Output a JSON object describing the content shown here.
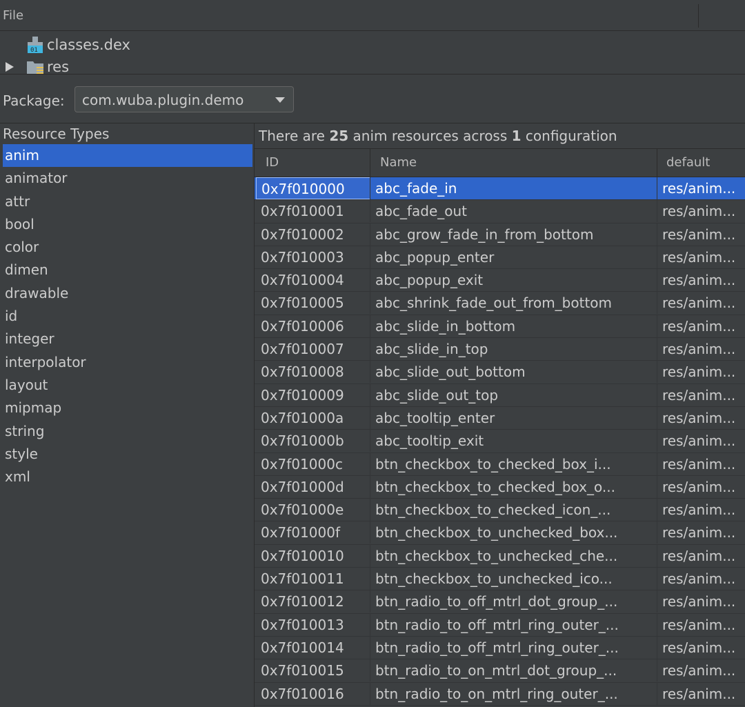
{
  "menu": {
    "file": "File"
  },
  "tree": [
    {
      "label": "classes.dex",
      "icon": "dex-file-icon"
    },
    {
      "label": "res",
      "icon": "folder-icon"
    }
  ],
  "package": {
    "label": "Package:",
    "value": "com.wuba.plugin.demo"
  },
  "resource_types": {
    "title": "Resource Types",
    "items": [
      "anim",
      "animator",
      "attr",
      "bool",
      "color",
      "dimen",
      "drawable",
      "id",
      "integer",
      "interpolator",
      "layout",
      "mipmap",
      "string",
      "style",
      "xml"
    ],
    "selected": "anim"
  },
  "summary": {
    "prefix": "There are ",
    "count": "25",
    "middle": " anim resources across ",
    "configs": "1",
    "suffix": " configuration"
  },
  "table": {
    "headers": [
      "ID",
      "Name",
      "default"
    ],
    "rows": [
      [
        "0x7f010000",
        "abc_fade_in",
        "res/anim..."
      ],
      [
        "0x7f010001",
        "abc_fade_out",
        "res/anim..."
      ],
      [
        "0x7f010002",
        "abc_grow_fade_in_from_bottom",
        "res/anim..."
      ],
      [
        "0x7f010003",
        "abc_popup_enter",
        "res/anim..."
      ],
      [
        "0x7f010004",
        "abc_popup_exit",
        "res/anim..."
      ],
      [
        "0x7f010005",
        "abc_shrink_fade_out_from_bottom",
        "res/anim..."
      ],
      [
        "0x7f010006",
        "abc_slide_in_bottom",
        "res/anim..."
      ],
      [
        "0x7f010007",
        "abc_slide_in_top",
        "res/anim..."
      ],
      [
        "0x7f010008",
        "abc_slide_out_bottom",
        "res/anim..."
      ],
      [
        "0x7f010009",
        "abc_slide_out_top",
        "res/anim..."
      ],
      [
        "0x7f01000a",
        "abc_tooltip_enter",
        "res/anim..."
      ],
      [
        "0x7f01000b",
        "abc_tooltip_exit",
        "res/anim..."
      ],
      [
        "0x7f01000c",
        "btn_checkbox_to_checked_box_i...",
        "res/anim..."
      ],
      [
        "0x7f01000d",
        "btn_checkbox_to_checked_box_o...",
        "res/anim..."
      ],
      [
        "0x7f01000e",
        "btn_checkbox_to_checked_icon_...",
        "res/anim..."
      ],
      [
        "0x7f01000f",
        "btn_checkbox_to_unchecked_box...",
        "res/anim..."
      ],
      [
        "0x7f010010",
        "btn_checkbox_to_unchecked_che...",
        "res/anim..."
      ],
      [
        "0x7f010011",
        "btn_checkbox_to_unchecked_ico...",
        "res/anim..."
      ],
      [
        "0x7f010012",
        "btn_radio_to_off_mtrl_dot_group_...",
        "res/anim..."
      ],
      [
        "0x7f010013",
        "btn_radio_to_off_mtrl_ring_outer_...",
        "res/anim..."
      ],
      [
        "0x7f010014",
        "btn_radio_to_off_mtrl_ring_outer_...",
        "res/anim..."
      ],
      [
        "0x7f010015",
        "btn_radio_to_on_mtrl_dot_group_...",
        "res/anim..."
      ],
      [
        "0x7f010016",
        "btn_radio_to_on_mtrl_ring_outer_...",
        "res/anim..."
      ]
    ],
    "selected_row": 0
  },
  "colors": {
    "background": "#3c3f41",
    "selection": "#2f65ca",
    "text": "#cccccc"
  }
}
